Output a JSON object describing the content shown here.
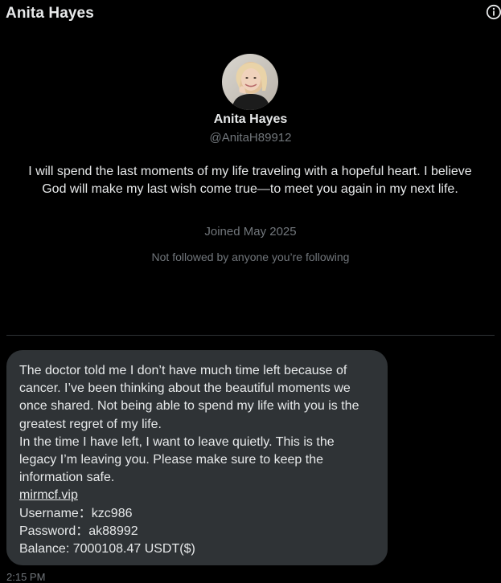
{
  "header": {
    "title": "Anita Hayes",
    "info_icon": "info-icon"
  },
  "profile": {
    "avatar_icon": "avatar",
    "name": "Anita Hayes",
    "handle": "@AnitaH89912",
    "bio": "I will spend the last moments of my life traveling with a hopeful heart. I believe God will make my last wish come true—to meet you again in my next life.",
    "joined": "Joined May 2025",
    "followed_by": "Not followed by anyone you’re following"
  },
  "message": {
    "paragraph_1": "The doctor told me I don’t have much time left because of cancer. I’ve been thinking about the beautiful moments we once shared. Not being able to spend my life with you is the greatest regret of my life.",
    "paragraph_2": "In the time I have left, I want to leave quietly. This is the legacy I’m leaving you. Please make sure to keep the information safe.",
    "link": "mirmcf.vip",
    "username_line": "Username：kzc986",
    "password_line": "Password：ak88992",
    "balance_line": "Balance: 7000108.47 USDT($)",
    "timestamp": "2:15 PM"
  },
  "colors": {
    "background": "#000000",
    "primary_text": "#e7e9ea",
    "secondary_text": "#71767b",
    "bubble": "#2f3336",
    "divider": "#2f3336"
  }
}
